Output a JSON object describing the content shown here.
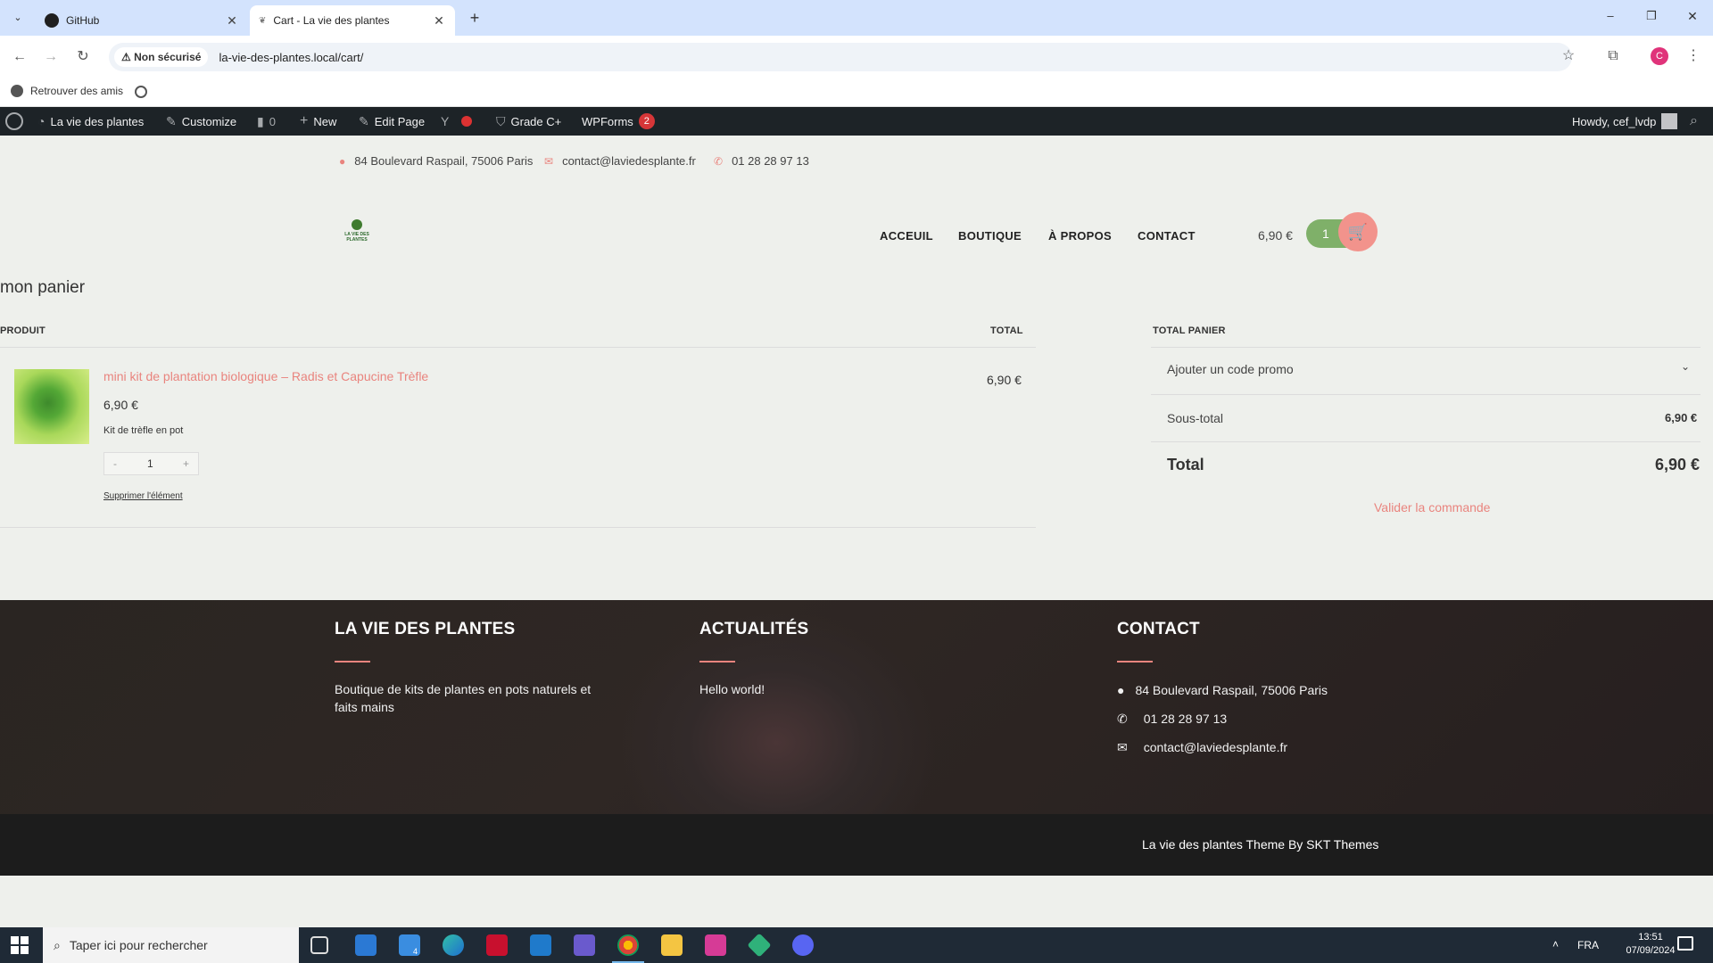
{
  "browser": {
    "tabs": [
      {
        "title": "GitHub",
        "close": "✕"
      },
      {
        "title": "Cart - La vie des plantes",
        "close": "✕"
      }
    ],
    "new_tab": "+",
    "security_label": "Non sécurisé",
    "url": "la-vie-des-plantes.local/cart/",
    "profile_initial": "C",
    "bookmark": "Retrouver des amis",
    "window_controls": [
      "–",
      "❐",
      "✕"
    ]
  },
  "adminbar": {
    "site_name": "La vie des plantes",
    "customize": "Customize",
    "comments_count": "0",
    "new": "New",
    "edit_page": "Edit Page",
    "grade": "Grade C+",
    "wpforms": "WPForms",
    "wpforms_count": "2",
    "howdy": "Howdy, cef_lvdp"
  },
  "topinfo": {
    "address": "84 Boulevard Raspail, 75006 Paris",
    "email": "contact@laviedesplante.fr",
    "phone": "01 28 28 97 13"
  },
  "header": {
    "logo_text": "LA VIE DES PLANTES",
    "nav": [
      "ACCEUIL",
      "BOUTIQUE",
      "À PROPOS",
      "CONTACT"
    ],
    "cart_total": "6,90 €",
    "cart_count": "1"
  },
  "cart": {
    "title": "mon panier",
    "col_product": "PRODUIT",
    "col_total": "TOTAL",
    "item": {
      "name": "mini kit de plantation biologique – Radis et Capucine Trèfle",
      "price": "6,90 €",
      "description": "Kit de trèfle en pot",
      "qty": "1",
      "minus": "-",
      "plus": "+",
      "remove": "Supprimer l'élément",
      "line_total": "6,90 €"
    }
  },
  "summary": {
    "title": "TOTAL PANIER",
    "promo": "Ajouter un code promo",
    "subtotal_label": "Sous-total",
    "subtotal_value": "6,90 €",
    "total_label": "Total",
    "total_value": "6,90 €",
    "checkout": "Valider la commande"
  },
  "footer": {
    "col1_title": "LA VIE DES PLANTES",
    "col1_text": "Boutique de kits de plantes en pots naturels et faits mains",
    "col2_title": "ACTUALITÉS",
    "col2_text": "Hello world!",
    "col3_title": "CONTACT",
    "address": "84 Boulevard Raspail, 75006 Paris",
    "phone": "01 28 28 97 13",
    "email": "contact@laviedesplante.fr",
    "credit": "La vie des plantes Theme By SKT Themes"
  },
  "taskbar": {
    "search_placeholder": "Taper ici pour rechercher",
    "mail_badge": "4",
    "lang": "FRA",
    "time": "13:51",
    "date": "07/09/2024"
  }
}
